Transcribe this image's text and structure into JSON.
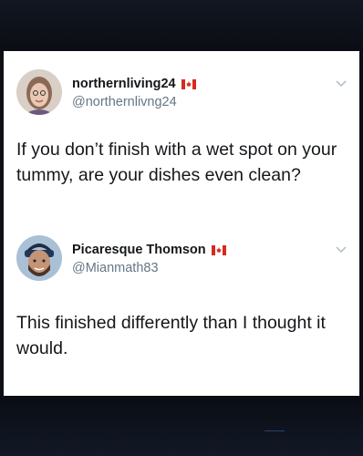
{
  "colors": {
    "background": "#0c0f14",
    "card": "#ffffff",
    "name": "#14171a",
    "handle": "#657786",
    "flag_red": "#d52b1e"
  },
  "tweets": [
    {
      "display_name": "northernliving24",
      "flag_icon": "canada-flag-icon",
      "handle": "@northernlivng24",
      "text": "If you don’t finish with a wet spot on your tummy, are your dishes even clean?"
    },
    {
      "display_name": "Picaresque Thomson",
      "flag_icon": "canada-flag-icon",
      "handle": "@Mianmath83",
      "text": "This finished differently than I thought it would."
    }
  ]
}
